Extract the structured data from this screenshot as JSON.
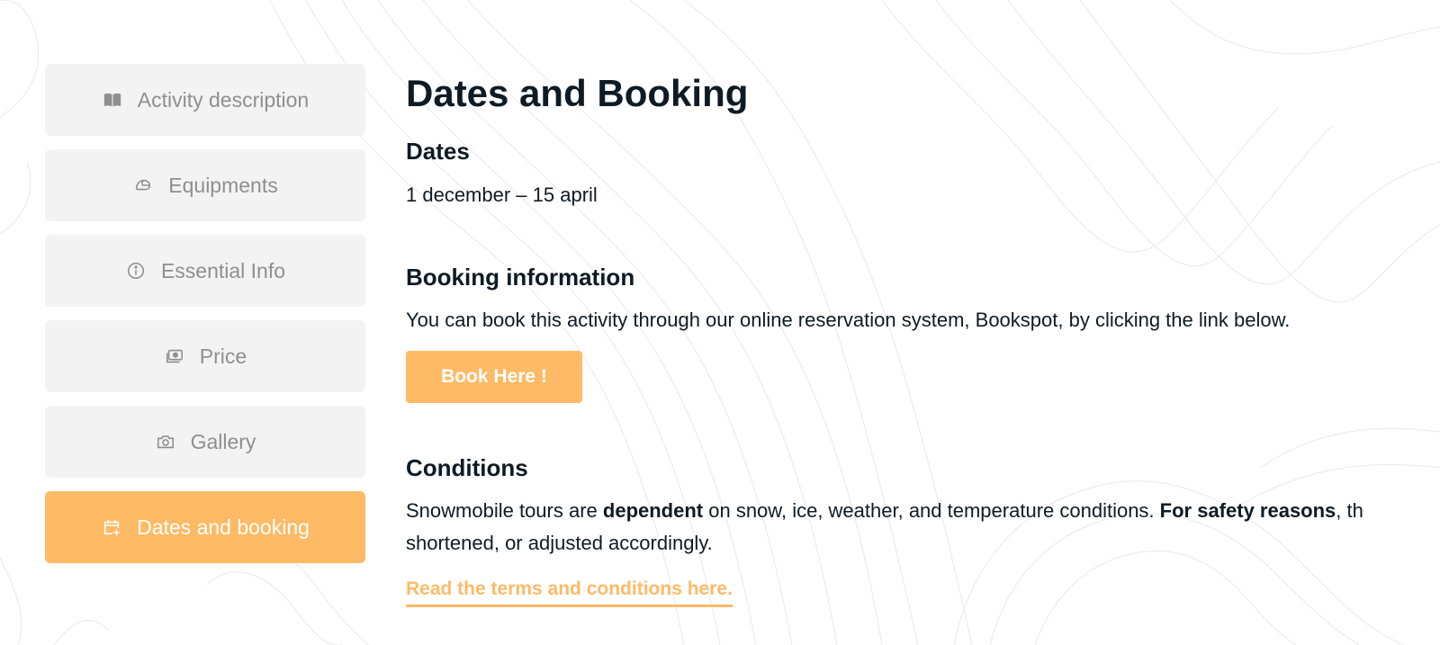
{
  "colors": {
    "accent": "#ffba66",
    "nav_bg": "#f3f3f3",
    "nav_text": "#8f8f8f",
    "heading_text": "#0f1b24"
  },
  "sidebar": {
    "items": [
      {
        "label": "Activity description",
        "icon": "book-icon",
        "active": false
      },
      {
        "label": "Equipments",
        "icon": "helmet-icon",
        "active": false
      },
      {
        "label": "Essential Info",
        "icon": "info-icon",
        "active": false
      },
      {
        "label": "Price",
        "icon": "money-icon",
        "active": false
      },
      {
        "label": "Gallery",
        "icon": "camera-icon",
        "active": false
      },
      {
        "label": "Dates and booking",
        "icon": "calendar-plus-icon",
        "active": true
      }
    ]
  },
  "main": {
    "title": "Dates and Booking",
    "dates": {
      "heading": "Dates",
      "text": "1 december – 15 april"
    },
    "booking": {
      "heading": "Booking information",
      "text": "You can book this activity through our online reservation system, Bookspot, by clicking the link below.",
      "button_label": "Book Here !"
    },
    "conditions": {
      "heading": "Conditions",
      "text_1": "Snowmobile tours are ",
      "bold_1": "dependent",
      "text_2": " on snow, ice, weather, and temperature conditions. ",
      "bold_2": "For safety reasons",
      "text_3": ", th",
      "line_2": "shortened, or adjusted accordingly.",
      "link_label": "Read the terms and conditions here."
    }
  }
}
